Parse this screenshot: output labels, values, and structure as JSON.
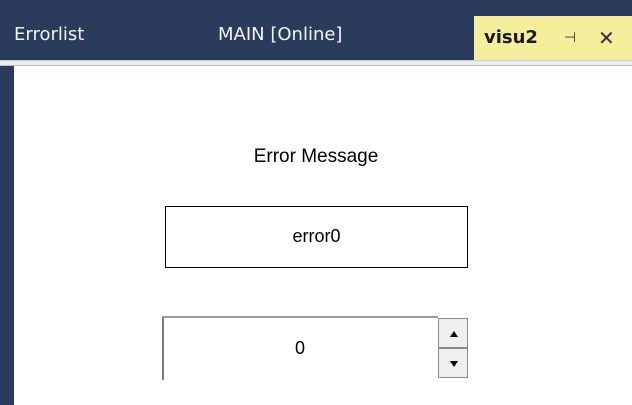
{
  "tabs": [
    {
      "label": "Errorlist"
    },
    {
      "label": "MAIN [Online]"
    },
    {
      "label": "visu2",
      "active": true,
      "pin_icon": "pin-icon",
      "close_icon": "close-icon",
      "close_glyph": "✕",
      "pin_glyph": "⊣"
    }
  ],
  "visu": {
    "caption": "Error Message",
    "message_value": "error0",
    "spinner_value": "0"
  },
  "colors": {
    "tabstrip": "#2b3b5b",
    "active_tab": "#f5ee9c"
  }
}
